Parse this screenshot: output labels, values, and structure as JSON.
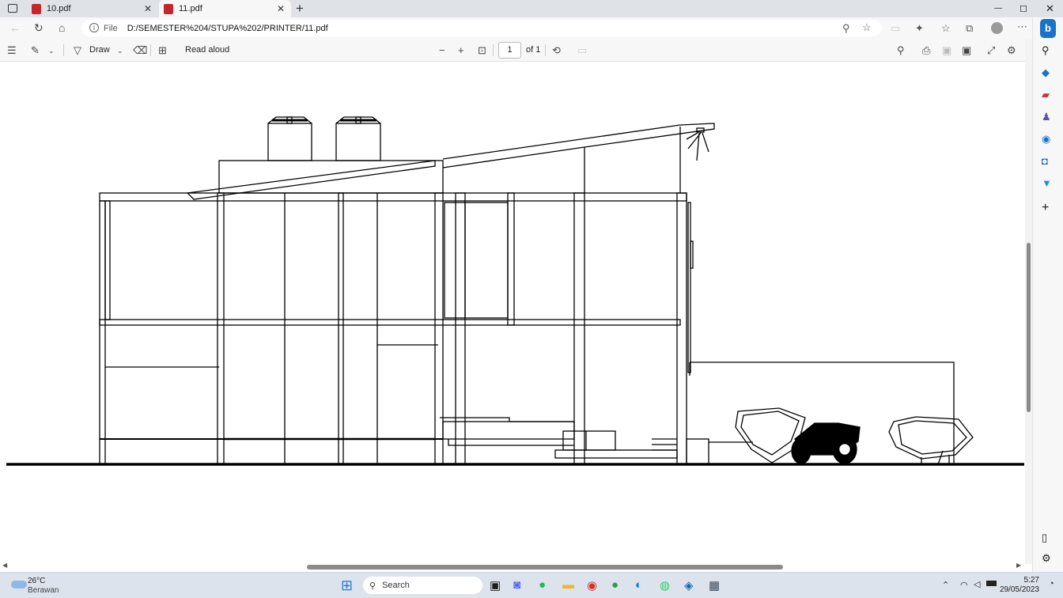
{
  "tabs": [
    {
      "label": "10.pdf",
      "active": false
    },
    {
      "label": "11.pdf",
      "active": true
    }
  ],
  "new_tab": "+",
  "window": {
    "minimize": "—",
    "maximize": "◻",
    "close": "✕"
  },
  "address": {
    "prefix": "File",
    "url": "D:/SEMESTER%204/STUPA%202/PRINTER/11.pdf"
  },
  "pdf_toolbar": {
    "draw_label": "Draw",
    "read_aloud": "Read aloud",
    "page_current": "1",
    "page_total": "of 1"
  },
  "taskbar": {
    "search_placeholder": "Search",
    "temperature": "26°C",
    "weather_text": "Berawan",
    "time": "5:27",
    "date": "29/05/2023"
  }
}
